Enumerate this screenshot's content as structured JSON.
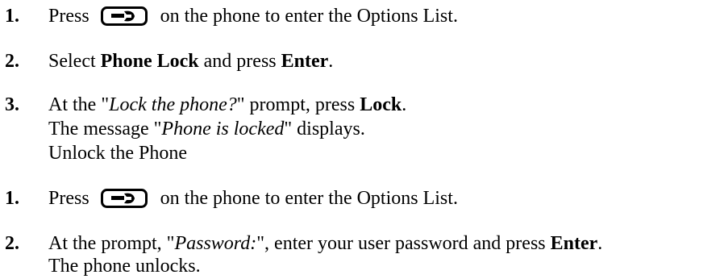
{
  "lock_steps": [
    {
      "num": "1.",
      "pre": "Press",
      "post": "on the phone to enter the Options List."
    },
    {
      "num": "2.",
      "a": "Select ",
      "b1": "Phone Lock",
      "c": " and press ",
      "b2": "Enter",
      "d": "."
    },
    {
      "num": "3.",
      "a": "At the \"",
      "i1": "Lock the phone?",
      "c": "\" prompt, press ",
      "b1": "Lock",
      "d": ".",
      "line2_a": "The message \"",
      "line2_i": "Phone is locked",
      "line2_b": "\" displays."
    }
  ],
  "section_heading": "Unlock the Phone",
  "unlock_steps": [
    {
      "num": "1.",
      "pre": "Press",
      "post": "on the phone to enter the Options List."
    },
    {
      "num": "2.",
      "a": "At the prompt, \"",
      "i1": "Password:",
      "c": "\", enter your user password and press ",
      "b1": "Enter",
      "d": ".",
      "line2": "The phone unlocks."
    }
  ],
  "icons": {
    "options_key": "options-wrench-key-icon"
  }
}
